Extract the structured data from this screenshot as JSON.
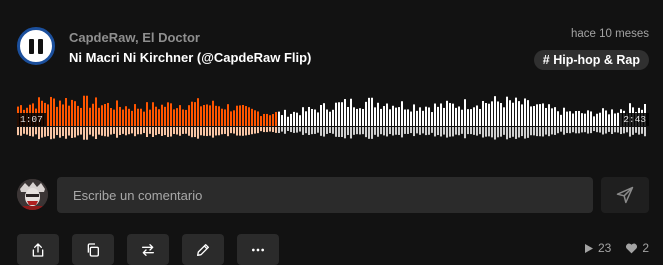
{
  "track": {
    "artist": "CapdeRaw, El Doctor",
    "title": "Ni Macri Ni Kirchner (@CapdeRaw Flip)",
    "posted": "hace 10 meses",
    "genre": "# Hip-hop & Rap",
    "current_time": "1:07",
    "total_time": "2:43",
    "progress_fraction": 0.41
  },
  "colors": {
    "played": "#ff5500",
    "played_reflection": "#f7c4a4",
    "unplayed": "#ffffff",
    "background": "#121212"
  },
  "comment": {
    "placeholder": "Escribe un comentario"
  },
  "stats": {
    "plays": "23",
    "likes": "2"
  },
  "icons": {
    "play_state": "pause-icon",
    "send": "send-icon",
    "actions": [
      "share-icon",
      "copy-icon",
      "repost-icon",
      "edit-icon",
      "more-icon"
    ],
    "plays": "play-icon",
    "likes": "heart-icon"
  }
}
